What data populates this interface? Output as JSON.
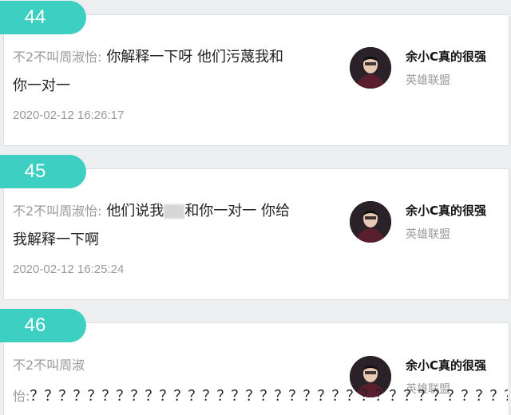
{
  "comments": [
    {
      "number": "44",
      "sender": "不2不叫周淑怡:",
      "text_line1": "你解释一下呀 他们污蔑我和",
      "text_line2": "你一对一",
      "time": "2020-02-12 16:26:17",
      "user_name": "余小C真的很强",
      "user_game": "英雄联盟"
    },
    {
      "number": "45",
      "sender": "不2不叫周淑怡:",
      "text_before_blur": "他们说我",
      "text_after_blur": "和你一对一 你给",
      "text_line2": "我解释一下啊",
      "time": "2020-02-12 16:25:24",
      "user_name": "余小C真的很强",
      "user_game": "英雄联盟"
    },
    {
      "number": "46",
      "sender_line1": "不2不叫周淑",
      "sender_line2": "怡:",
      "text_line2": "？？？？？？？？？？？？？？？？？？？？？？？？？？？？？？？？？？",
      "user_name": "余小C真的很强",
      "user_game": "英雄联盟"
    }
  ],
  "colors": {
    "tab": "#3ecfc3",
    "muted": "#9a9a9a"
  }
}
